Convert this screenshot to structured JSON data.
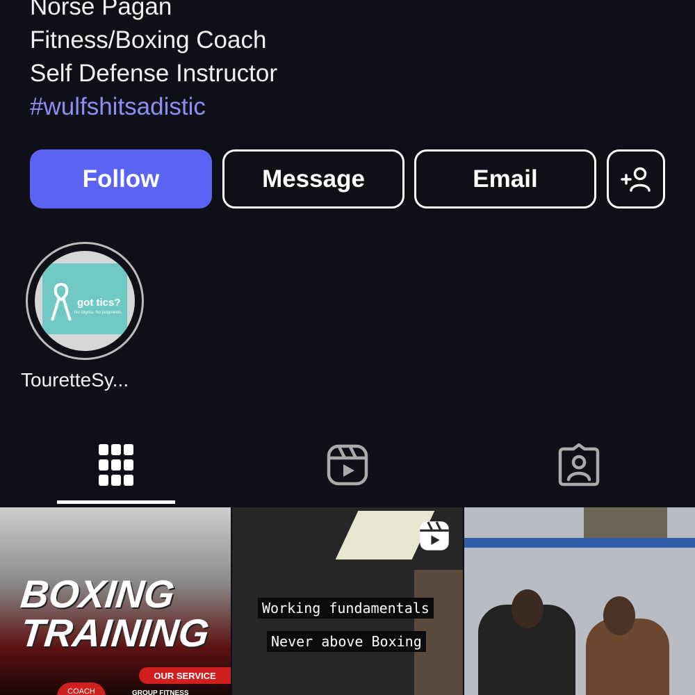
{
  "bio": {
    "lines": [
      "Norse Pagan",
      "Fitness/Boxing Coach",
      "Self Defense Instructor"
    ],
    "hashtag": "#wulfshitsadistic"
  },
  "actions": {
    "follow_label": "Follow",
    "message_label": "Message",
    "email_label": "Email",
    "add_user_icon": "add-person-icon"
  },
  "highlights": [
    {
      "label": "TouretteSy...",
      "thumb_headline": "got tics?",
      "thumb_sub": "No stigma. No judgments."
    }
  ],
  "tabs": [
    {
      "name": "posts-grid",
      "icon": "grid-icon",
      "active": true
    },
    {
      "name": "reels",
      "icon": "reels-icon",
      "active": false
    },
    {
      "name": "tagged",
      "icon": "tagged-person-icon",
      "active": false
    }
  ],
  "posts": [
    {
      "kind": "image",
      "title_line1": "BOXING",
      "title_line2": "TRAINING",
      "service_label": "OUR SERVICE",
      "coach_label": "COACH",
      "group_label": "GROUP FITNESS"
    },
    {
      "kind": "reel",
      "caption_line1": "Working fundamentals",
      "caption_line2": "Never above Boxing"
    },
    {
      "kind": "image"
    }
  ],
  "colors": {
    "background": "#0f0f17",
    "accent": "#5b63f2",
    "hashtag": "#8e8ff5"
  }
}
